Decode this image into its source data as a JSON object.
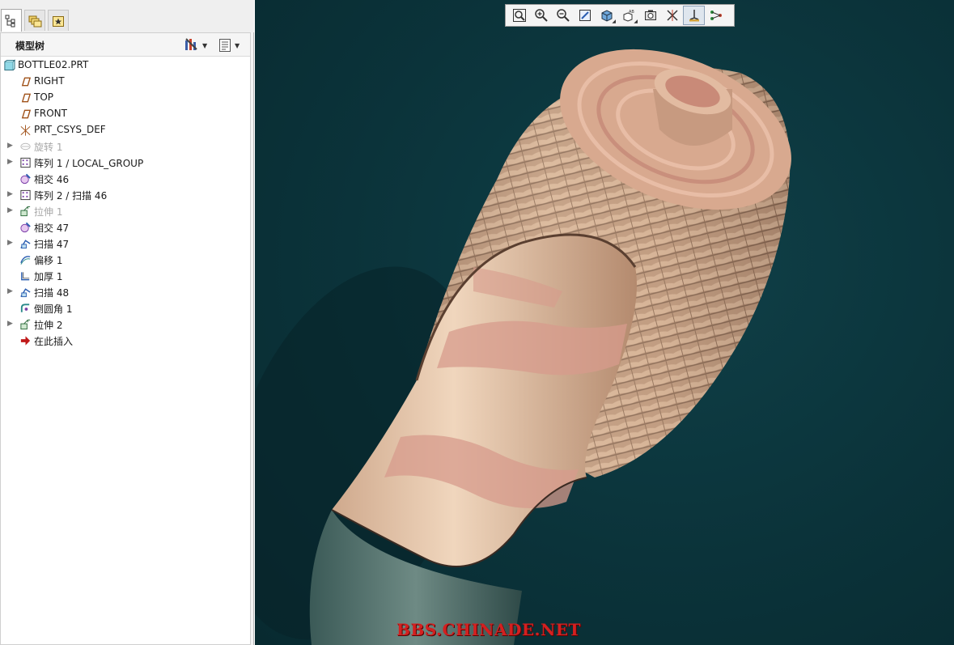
{
  "nav_tabs": [
    {
      "icon": "model-tree-icon",
      "active": true
    },
    {
      "icon": "folder-browser-icon",
      "active": false
    },
    {
      "icon": "favorites-icon",
      "active": false
    }
  ],
  "model_tree": {
    "title": "模型树",
    "settings_icon": "tree-settings-icon",
    "show_icon": "show-columns-icon",
    "items": [
      {
        "label": "BOTTLE02.PRT",
        "icon": "part-icon",
        "expandable": false,
        "dim": false,
        "root": true
      },
      {
        "label": "RIGHT",
        "icon": "datum-plane-icon",
        "expandable": false,
        "dim": false
      },
      {
        "label": "TOP",
        "icon": "datum-plane-icon",
        "expandable": false,
        "dim": false
      },
      {
        "label": "FRONT",
        "icon": "datum-plane-icon",
        "expandable": false,
        "dim": false
      },
      {
        "label": "PRT_CSYS_DEF",
        "icon": "coordinate-system-icon",
        "expandable": false,
        "dim": false
      },
      {
        "label": "旋转 1",
        "icon": "revolve-icon",
        "expandable": true,
        "dim": true
      },
      {
        "label": "阵列 1 / LOCAL_GROUP",
        "icon": "pattern-icon",
        "expandable": true,
        "dim": false
      },
      {
        "label": "相交 46",
        "icon": "intersect-icon",
        "expandable": false,
        "dim": false
      },
      {
        "label": "阵列 2 / 扫描 46",
        "icon": "pattern-icon",
        "expandable": true,
        "dim": false
      },
      {
        "label": "拉伸 1",
        "icon": "extrude-icon",
        "expandable": true,
        "dim": true
      },
      {
        "label": "相交 47",
        "icon": "intersect-icon",
        "expandable": false,
        "dim": false
      },
      {
        "label": "扫描 47",
        "icon": "sweep-icon",
        "expandable": true,
        "dim": false
      },
      {
        "label": "偏移 1",
        "icon": "offset-icon",
        "expandable": false,
        "dim": false
      },
      {
        "label": "加厚 1",
        "icon": "thicken-icon",
        "expandable": false,
        "dim": false
      },
      {
        "label": "扫描 48",
        "icon": "sweep-icon",
        "expandable": true,
        "dim": false
      },
      {
        "label": "倒圆角 1",
        "icon": "round-icon",
        "expandable": false,
        "dim": false
      },
      {
        "label": "拉伸 2",
        "icon": "extrude-icon",
        "expandable": true,
        "dim": false
      },
      {
        "label": "在此插入",
        "icon": "insert-here-arrow-icon",
        "expandable": false,
        "dim": false
      }
    ]
  },
  "view_toolbar": {
    "buttons": [
      {
        "icon": "refit-icon"
      },
      {
        "icon": "zoom-in-icon"
      },
      {
        "icon": "zoom-out-icon"
      },
      {
        "icon": "repaint-icon"
      },
      {
        "icon": "display-style-icon"
      },
      {
        "icon": "saved-orientations-icon"
      },
      {
        "icon": "view-manager-icon"
      },
      {
        "icon": "datum-display-icon"
      },
      {
        "icon": "spin-center-icon",
        "pressed": true
      },
      {
        "icon": "annotation-display-icon"
      }
    ]
  },
  "watermark": "BBS.CHINADE.NET",
  "colors": {
    "viewport_bg": "#0b333a",
    "model_base": "#d8b394",
    "model_pink": "#d79b8c",
    "watermark": "#d42020"
  }
}
